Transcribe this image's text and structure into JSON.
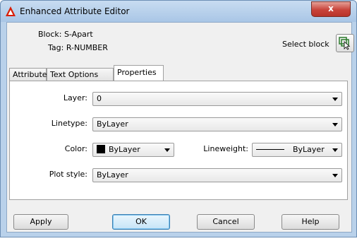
{
  "window": {
    "title": "Enhanced Attribute Editor",
    "close_label": "x",
    "accent_color": "#d81e05"
  },
  "header": {
    "block_text": "Block: S-Apart",
    "tag_text": "Tag: R-NUMBER",
    "select_block_label": "Select block",
    "select_block_icon": "select-object-icon"
  },
  "tabs": [
    {
      "label": "Attribute",
      "active": false
    },
    {
      "label": "Text Options",
      "active": false
    },
    {
      "label": "Properties",
      "active": true
    }
  ],
  "properties": {
    "layer": {
      "label": "Layer:",
      "value": "0"
    },
    "linetype": {
      "label": "Linetype:",
      "value": "ByLayer"
    },
    "color": {
      "label": "Color:",
      "value": "ByLayer",
      "swatch_color": "#000000"
    },
    "lineweight": {
      "label": "Lineweight:",
      "value": "ByLayer"
    },
    "plot_style": {
      "label": "Plot style:",
      "value": "ByLayer"
    }
  },
  "buttons": {
    "apply": "Apply",
    "ok": "OK",
    "cancel": "Cancel",
    "help": "Help"
  }
}
